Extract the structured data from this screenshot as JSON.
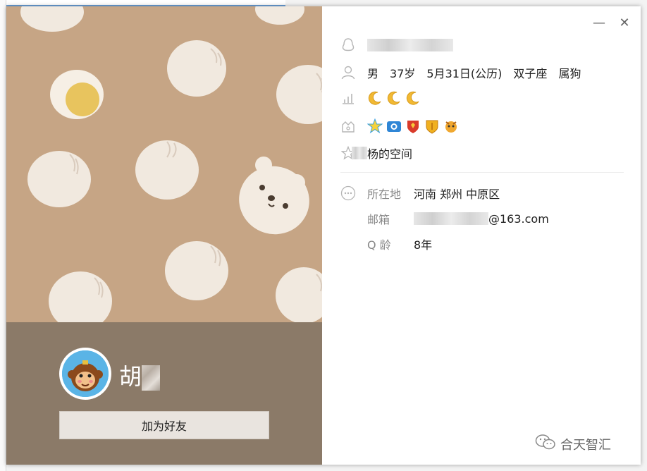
{
  "window": {
    "minimize_glyph": "—",
    "close_glyph": "✕"
  },
  "profile": {
    "nickname": "胡",
    "add_friend_label": "加为好友"
  },
  "info": {
    "gender": "男",
    "age": "37岁",
    "birthday": "5月31日(公历)",
    "zodiac": "双子座",
    "chinese_zodiac": "属狗",
    "space_text": "的空间",
    "location_label": "所在地",
    "location_value": "河南 郑州 中原区",
    "email_label": "邮箱",
    "email_value": "@163.com",
    "qage_label": "Q 龄",
    "qage_value": "8年"
  },
  "level": {
    "moons": 3
  },
  "badges": [
    "star-badge",
    "camera-badge",
    "red-shield-badge",
    "gold-shield-badge",
    "pet-badge"
  ],
  "icons": [
    "qq-penguin-icon",
    "person-icon",
    "level-chart-icon",
    "crown-icon",
    "star-outline-icon",
    "more-icon"
  ],
  "watermark": {
    "text": "合天智汇"
  },
  "colors": {
    "cover": "#c9a887",
    "profile_band": "#8b7a68",
    "moon": "#f2b933"
  }
}
